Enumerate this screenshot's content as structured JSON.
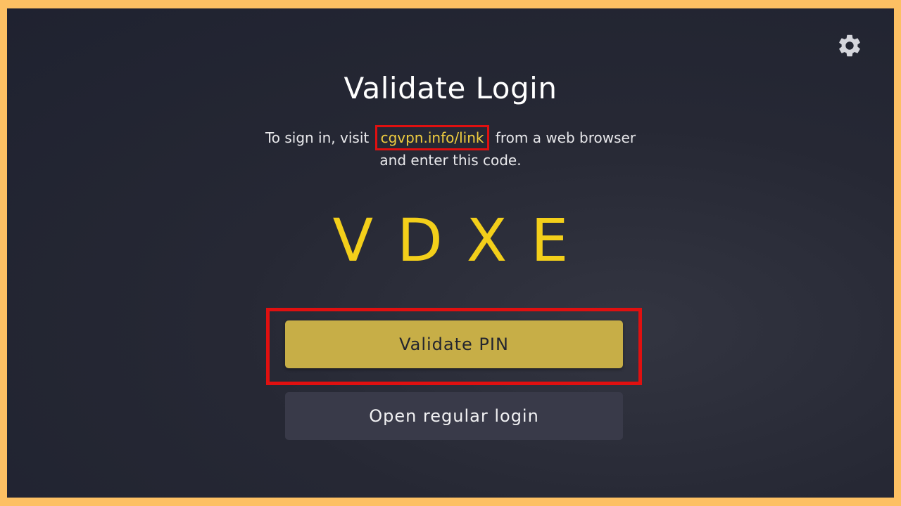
{
  "title": "Validate Login",
  "instructions": {
    "before_link": "To sign in, visit ",
    "link": "cgvpn.info/link",
    "after_link": " from a web browser",
    "line2": "and enter this code."
  },
  "code": "VDXE",
  "buttons": {
    "validate_pin": "Validate PIN",
    "open_regular_login": "Open regular login"
  },
  "icons": {
    "settings": "gear-icon"
  },
  "colors": {
    "frame": "#fdc063",
    "background": "#262834",
    "accent_yellow": "#f3cf1a",
    "link_yellow": "#f0cd3f",
    "primary_button": "#c7ae47",
    "secondary_button": "#393a49",
    "highlight_red": "#e01010"
  }
}
